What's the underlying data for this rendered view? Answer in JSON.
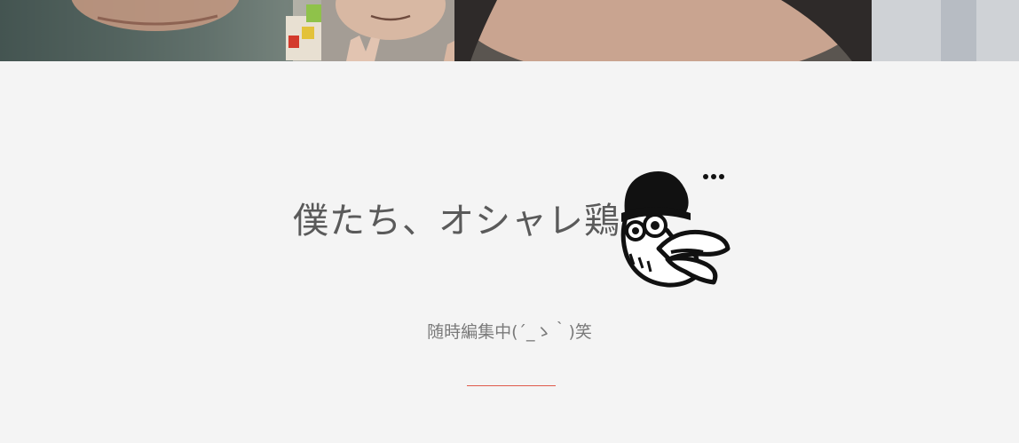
{
  "header": {
    "photo": "header-photo"
  },
  "hero": {
    "title": "僕たち、オシャレ鶏",
    "tagline": "随時編集中(´_ゝ｀)笑",
    "mascot_icon": "chicken-mascot-icon",
    "divider_color": "#e05a4a"
  }
}
